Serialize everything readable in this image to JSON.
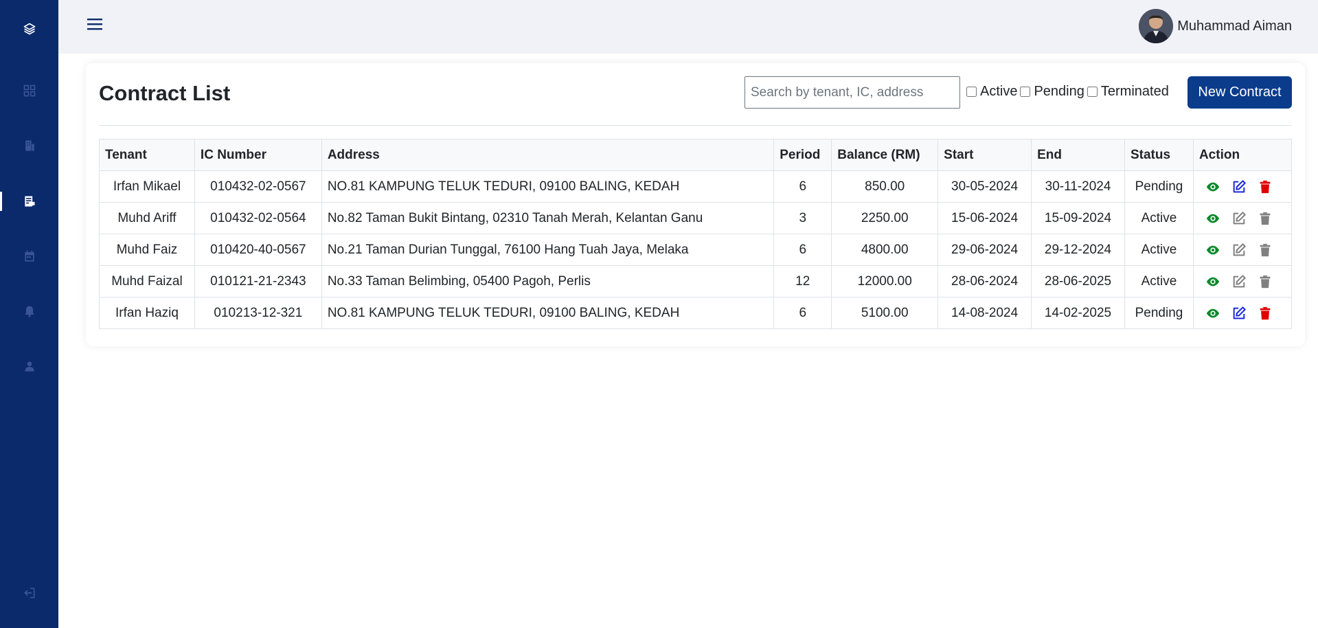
{
  "colors": {
    "sidebar": "#0b2a6b",
    "primary": "#0b3c8c",
    "view": "#0a8a2a",
    "edit_enabled": "#1a2bd8",
    "delete_enabled": "#e00000",
    "disabled": "#808080"
  },
  "sidebar": {
    "items": [
      {
        "icon": "layers-icon"
      },
      {
        "icon": "dashboard-icon"
      },
      {
        "icon": "property-icon"
      },
      {
        "icon": "contract-icon",
        "active": true
      },
      {
        "icon": "calendar-icon"
      },
      {
        "icon": "bell-icon"
      },
      {
        "icon": "user-icon"
      }
    ],
    "logout_icon": "logout-icon"
  },
  "topbar": {
    "menu_icon": "hamburger-icon",
    "user_name": "Muhammad Aiman"
  },
  "page": {
    "title": "Contract List",
    "search_placeholder": "Search by tenant, IC, address",
    "search_value": "",
    "filters": [
      {
        "label": "Active",
        "checked": false
      },
      {
        "label": "Pending",
        "checked": false
      },
      {
        "label": "Terminated",
        "checked": false
      }
    ],
    "new_button": "New Contract"
  },
  "table": {
    "headers": [
      "Tenant",
      "IC Number",
      "Address",
      "Period",
      "Balance (RM)",
      "Start",
      "End",
      "Status",
      "Action"
    ],
    "rows": [
      {
        "tenant": "Irfan Mikael",
        "ic": "010432-02-0567",
        "address": "NO.81 KAMPUNG TELUK TEDURI, 09100 BALING, KEDAH",
        "period": "6",
        "balance": "850.00",
        "start": "30-05-2024",
        "end": "30-11-2024",
        "status": "Pending",
        "editable": true
      },
      {
        "tenant": "Muhd Ariff",
        "ic": "010432-02-0564",
        "address": "No.82 Taman Bukit Bintang, 02310 Tanah Merah, Kelantan Ganu",
        "period": "3",
        "balance": "2250.00",
        "start": "15-06-2024",
        "end": "15-09-2024",
        "status": "Active",
        "editable": false
      },
      {
        "tenant": "Muhd Faiz",
        "ic": "010420-40-0567",
        "address": "No.21 Taman Durian Tunggal, 76100 Hang Tuah Jaya, Melaka",
        "period": "6",
        "balance": "4800.00",
        "start": "29-06-2024",
        "end": "29-12-2024",
        "status": "Active",
        "editable": false
      },
      {
        "tenant": "Muhd Faizal",
        "ic": "010121-21-2343",
        "address": "No.33 Taman Belimbing, 05400 Pagoh, Perlis",
        "period": "12",
        "balance": "12000.00",
        "start": "28-06-2024",
        "end": "28-06-2025",
        "status": "Active",
        "editable": false
      },
      {
        "tenant": "Irfan Haziq",
        "ic": "010213-12-321",
        "address": "NO.81 KAMPUNG TELUK TEDURI, 09100 BALING, KEDAH",
        "period": "6",
        "balance": "5100.00",
        "start": "14-08-2024",
        "end": "14-02-2025",
        "status": "Pending",
        "editable": true
      }
    ]
  }
}
